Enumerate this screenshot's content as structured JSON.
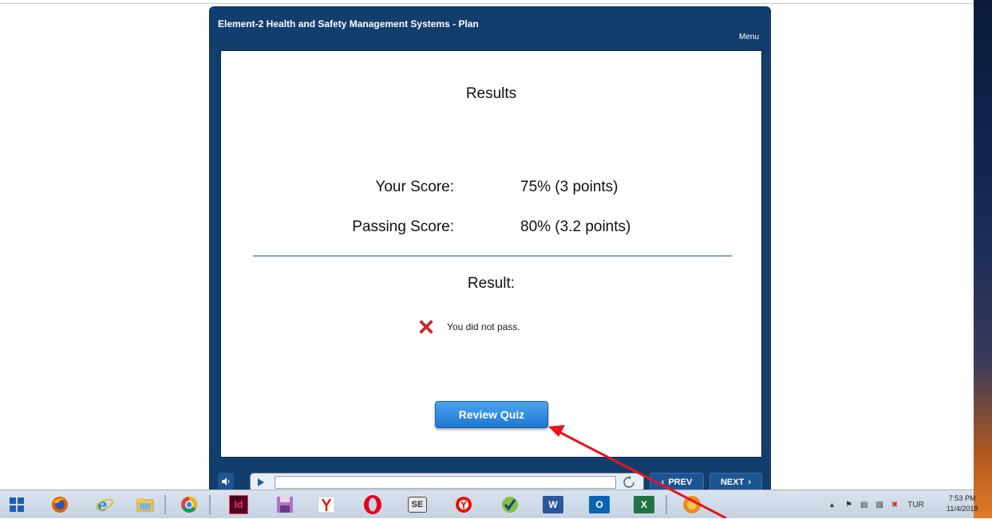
{
  "player": {
    "title": "Element-2 Health and Safety Management Systems - Plan",
    "menu_label": "Menu"
  },
  "results": {
    "heading": "Results",
    "your_score_label": "Your Score:",
    "your_score_value": "75% (3 points)",
    "passing_score_label": "Passing Score:",
    "passing_score_value": "80% (3.2 points)",
    "result_label": "Result:",
    "fail_message": "You did not pass.",
    "review_button": "Review Quiz"
  },
  "controls": {
    "prev_label": "PREV",
    "next_label": "NEXT"
  },
  "taskbar": {
    "apps": [
      "Start",
      "Firefox",
      "Internet Explorer",
      "File Explorer",
      "Chrome",
      "InDesign",
      "Save",
      "Yandex",
      "Opera",
      "SE",
      "Yandex Browser",
      "Checkmark App",
      "Word",
      "Outlook",
      "Excel",
      "Media"
    ],
    "app_letters": {
      "indesign": "Id",
      "se": "SE",
      "word": "W",
      "outlook": "O",
      "excel": "X"
    },
    "tray_language": "TUR",
    "clock_time": "7:53 PM",
    "clock_date": "11/4/2018"
  },
  "colors": {
    "player_bg": "#123e6e",
    "button_blue": "#1e78d2",
    "fail_red": "#e0282e",
    "annotation_arrow": "#e8141c"
  }
}
